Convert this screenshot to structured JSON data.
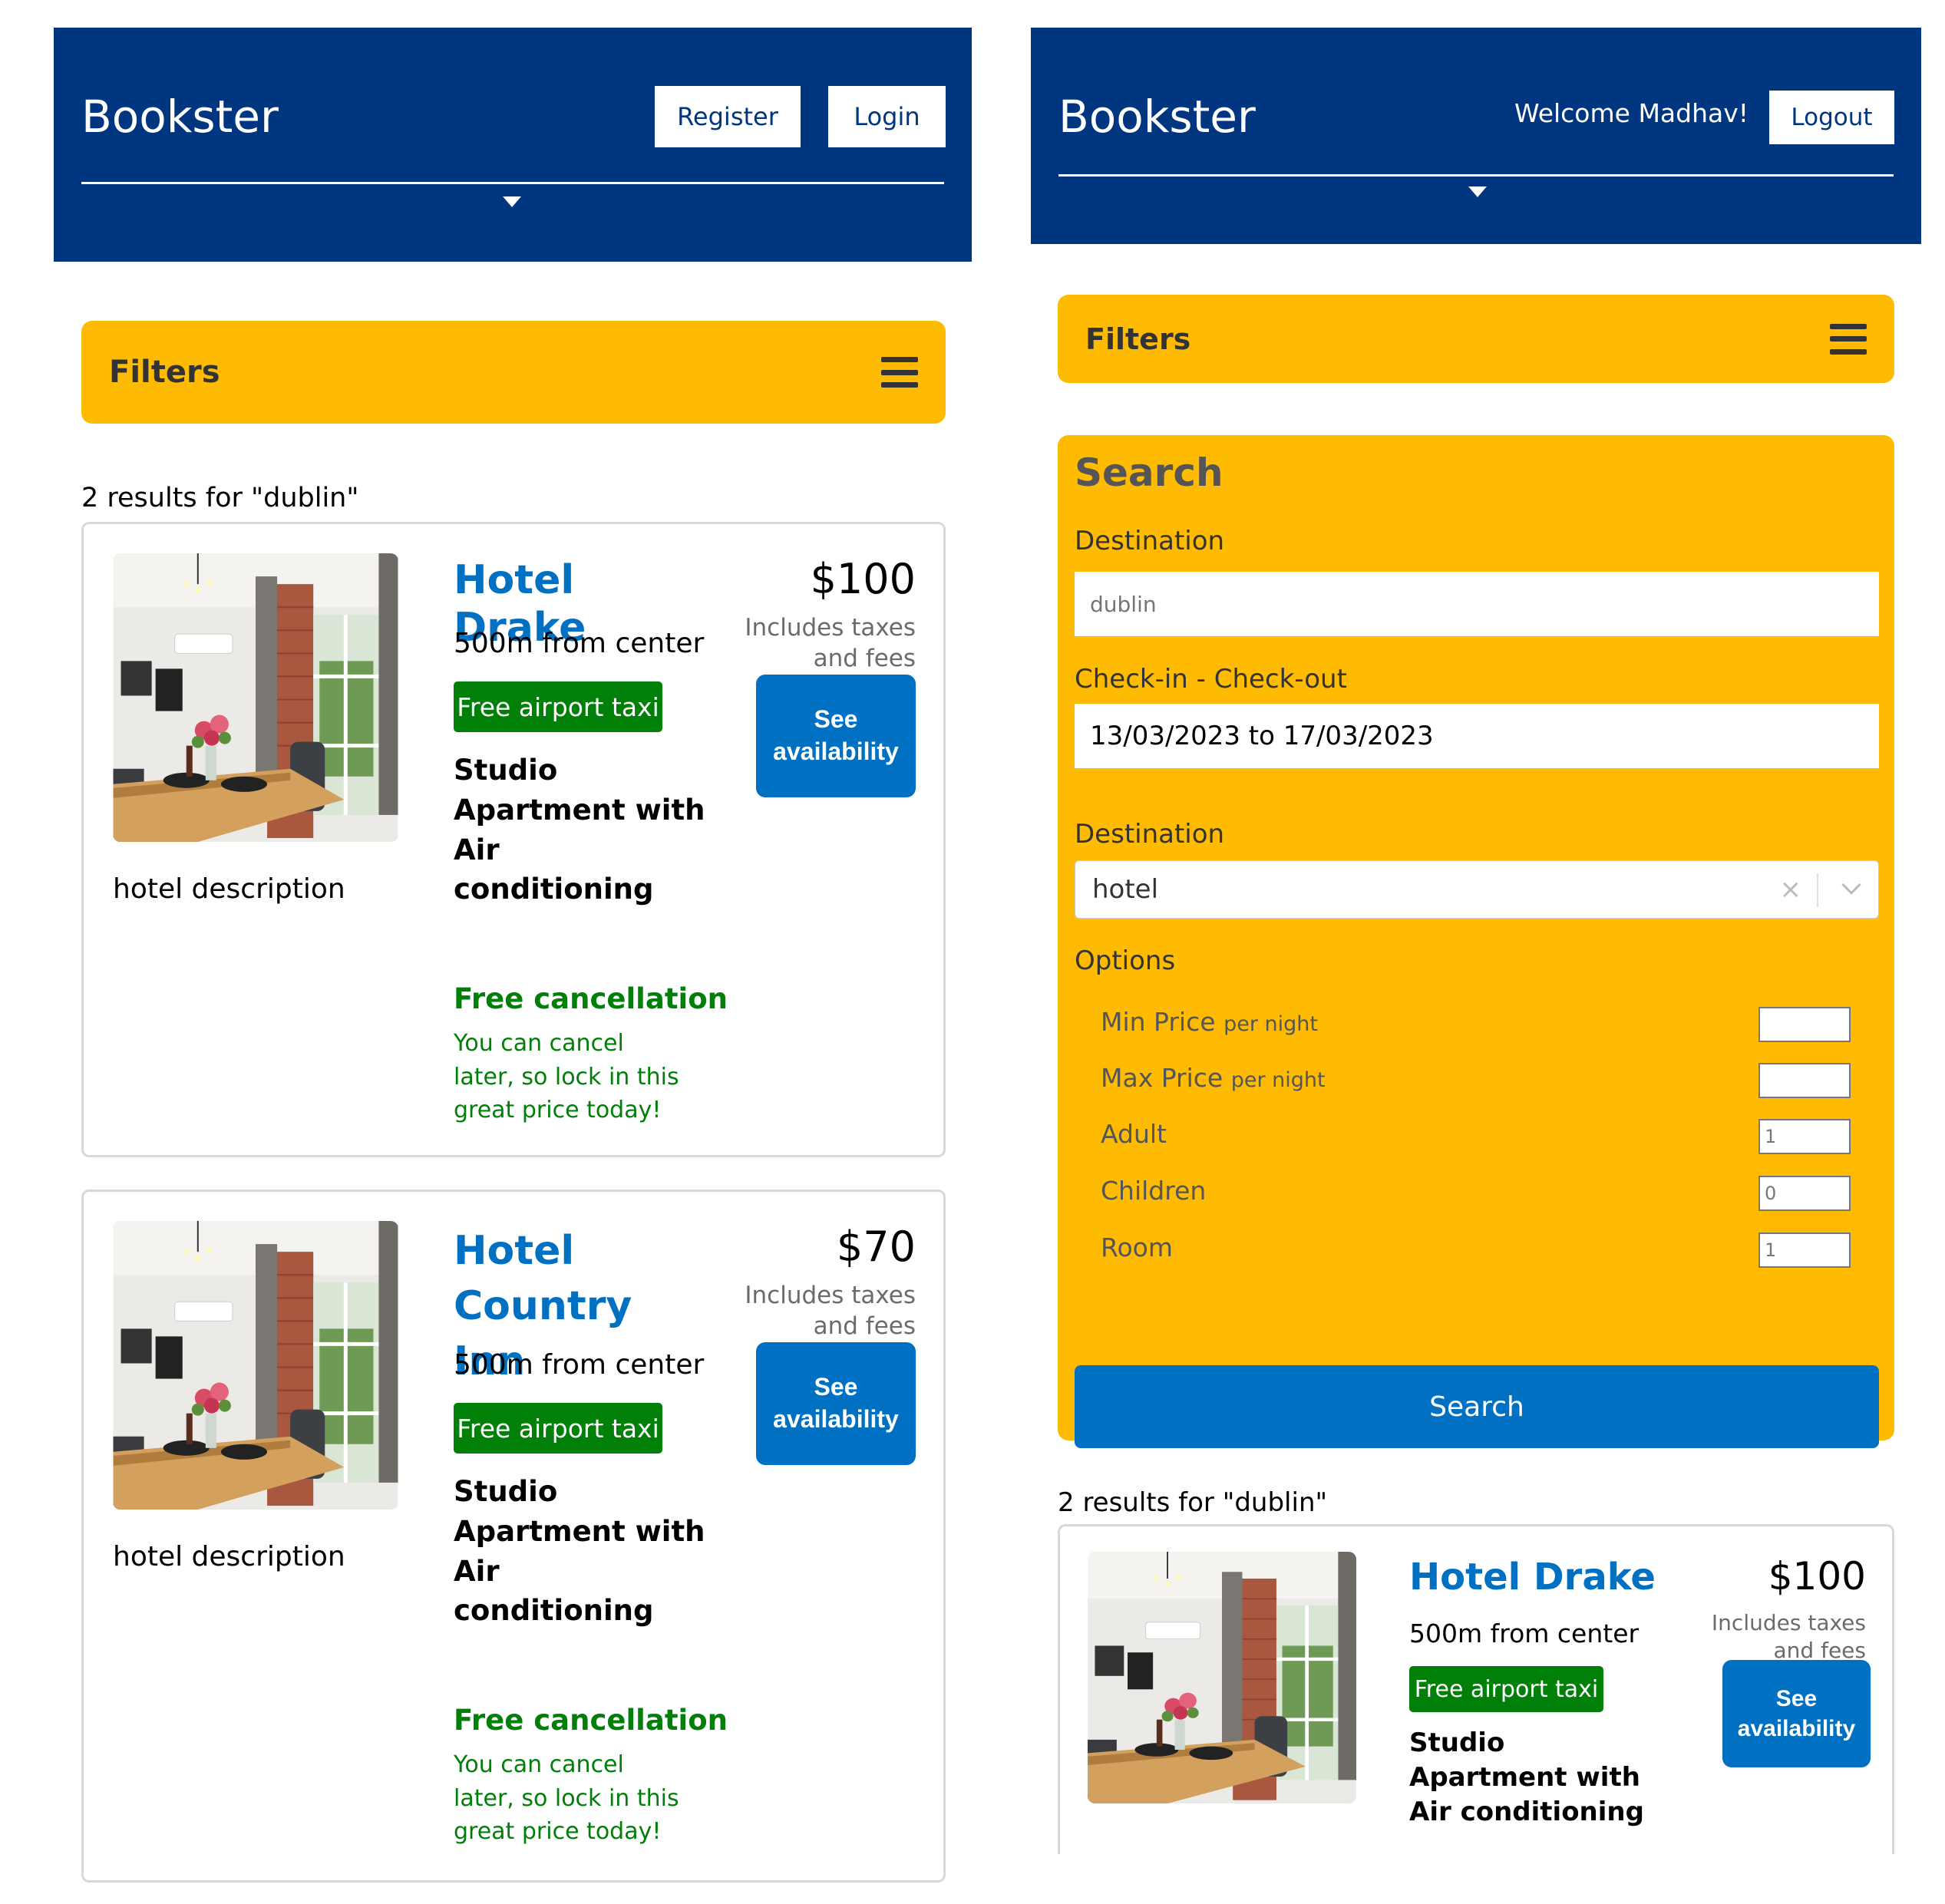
{
  "left": {
    "header": {
      "brand": "Bookster",
      "register_label": "Register",
      "login_label": "Login"
    },
    "filters_label": "Filters",
    "results_text": "2 results for \"dublin\"",
    "hotels": [
      {
        "name": "Hotel Drake",
        "distance": "500m from center",
        "taxi": "Free airport taxi",
        "room": "Studio Apartment with Air conditioning",
        "description": "hotel description",
        "price": "$100",
        "taxes": "Includes taxes and fees",
        "see_label": "See availability",
        "cancel_title": "Free cancellation",
        "cancel_sub": "You can cancel later, so lock in this great price today!"
      },
      {
        "name": "Hotel Country Inn",
        "distance": "500m from center",
        "taxi": "Free airport taxi",
        "room": "Studio Apartment with Air conditioning",
        "description": "hotel description",
        "price": "$70",
        "taxes": "Includes taxes and fees",
        "see_label": "See availability",
        "cancel_title": "Free cancellation",
        "cancel_sub": "You can cancel later, so lock in this great price today!"
      }
    ]
  },
  "right": {
    "header": {
      "brand": "Bookster",
      "welcome": "Welcome Madhav!",
      "logout_label": "Logout"
    },
    "filters_label": "Filters",
    "search": {
      "title": "Search",
      "destination_label": "Destination",
      "destination_placeholder": "dublin",
      "dates_label": "Check-in - Check-out",
      "dates_value": "13/03/2023 to 17/03/2023",
      "type_label": "Destination",
      "type_value": "hotel",
      "clear_symbol": "×",
      "options_label": "Options",
      "options": [
        {
          "label": "Min Price",
          "suffix": "per night",
          "value": ""
        },
        {
          "label": "Max Price",
          "suffix": "per night",
          "value": ""
        },
        {
          "label": "Adult",
          "suffix": "",
          "value": "1"
        },
        {
          "label": "Children",
          "suffix": "",
          "value": "0"
        },
        {
          "label": "Room",
          "suffix": "",
          "value": "1"
        }
      ],
      "button_label": "Search"
    },
    "results_text": "2 results for \"dublin\"",
    "hotel": {
      "name": "Hotel Drake",
      "distance": "500m from center",
      "taxi": "Free airport taxi",
      "room": "Studio Apartment with Air conditioning",
      "price": "$100",
      "taxes": "Includes taxes and fees",
      "see_label": "See availability"
    }
  }
}
